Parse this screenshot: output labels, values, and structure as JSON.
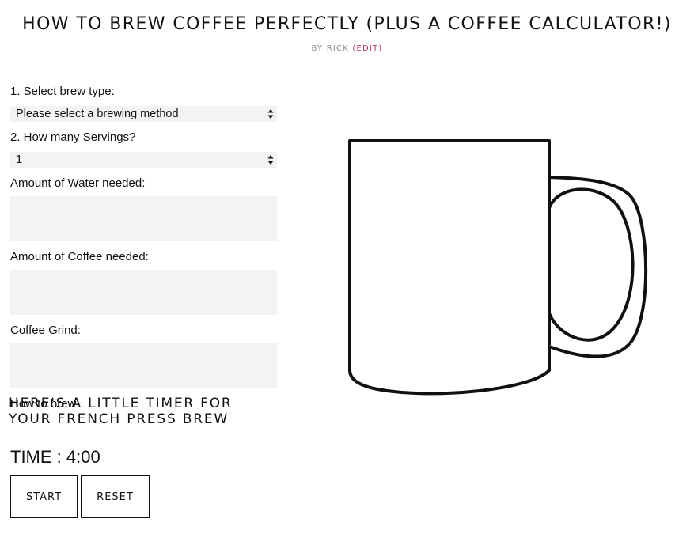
{
  "header": {
    "title": "HOW TO BREW COFFEE PERFECTLY (PLUS A COFFEE CALCULATOR!)",
    "byline_prefix": "BY RICK",
    "edit_link": "(EDIT)"
  },
  "calculator": {
    "brew_type_label": "1. Select brew type:",
    "brew_type_value": "Please select a brewing method",
    "servings_label": "2. How many Servings?",
    "servings_value": "1",
    "water_label": "Amount of Water needed:",
    "coffee_label": "Amount of Coffee needed:",
    "grind_label": "Coffee Grind:",
    "how_to_brew_label": "How to brew:"
  },
  "timer": {
    "heading": "HERE'S A LITTLE TIMER FOR YOUR FRENCH PRESS BREW",
    "time_text": "TIME : 4:00",
    "start_label": "START",
    "reset_label": "RESET"
  },
  "icons": {
    "mug": "coffee-mug-icon",
    "select_arrows": "select-arrows-icon"
  },
  "colors": {
    "edit_link": "#b0306e",
    "field_bg": "#f3f3f3"
  }
}
